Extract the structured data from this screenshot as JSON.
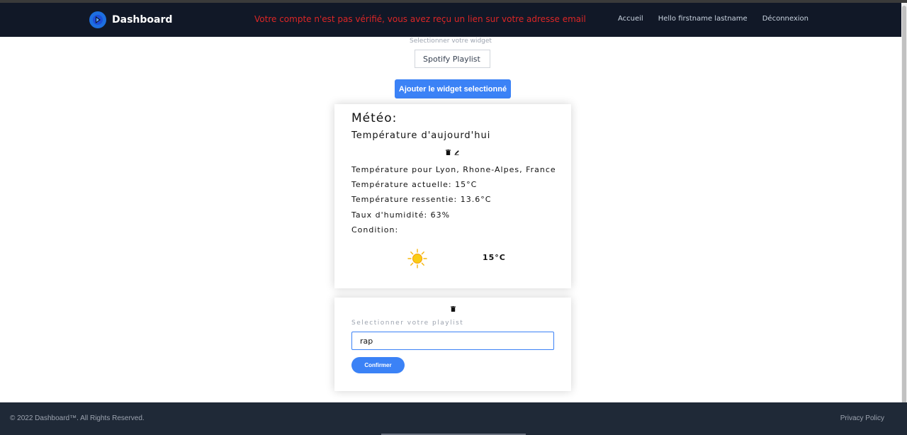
{
  "header": {
    "brand": "Dashboard",
    "alert": "Votre compte n'est pas vérifié, vous avez reçu un lien sur votre adresse email",
    "nav": {
      "home": "Accueil",
      "greeting": "Hello firstname lastname",
      "logout": "Déconnexion"
    }
  },
  "widget_selector": {
    "label": "Selectionner votre widget",
    "selected": "Spotify Playlist",
    "add_button": "Ajouter le widget selectionné"
  },
  "weather": {
    "title": "Météo:",
    "subtitle": "Température d'aujourd'hui",
    "location_line": "Température pour Lyon, Rhone-Alpes, France",
    "current_line": "Température actuelle: 15°C",
    "feels_like_line": "Température ressentie: 13.6°C",
    "humidity_line": "Taux d'humidité: 63%",
    "condition_line": "Condition:",
    "temperature_display": "15°C",
    "condition_icon": "sun-icon"
  },
  "playlist": {
    "label": "Selectionner votre playlist",
    "input_value": "rap",
    "confirm_button": "Confirmer"
  },
  "footer": {
    "copyright": "© 2022 Dashboard™. All Rights Reserved.",
    "privacy": "Privacy Policy"
  },
  "colors": {
    "navbar": "#111827",
    "alert": "#dc2626",
    "accent": "#3b82f6",
    "footer": "#1f2937"
  }
}
